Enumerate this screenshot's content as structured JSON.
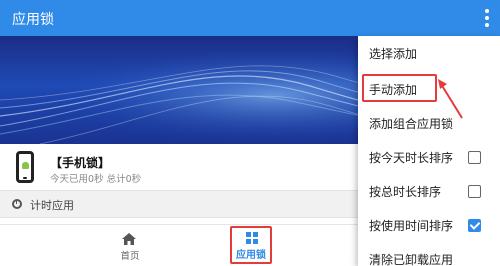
{
  "appbar": {
    "title": "应用锁",
    "more_icon": "more-vert-icon"
  },
  "info": {
    "title": "【手机锁】",
    "subtitle": "今天已用0秒 总计0秒",
    "icon": "phone-icon"
  },
  "section": {
    "label": "计时应用",
    "icon": "clock-icon"
  },
  "nav": {
    "home_label": "首页",
    "lock_label": "应用锁",
    "active_color": "#2f8ae8"
  },
  "menu": {
    "items": [
      {
        "label": "选择添加"
      },
      {
        "label": "手动添加"
      },
      {
        "label": "添加组合应用锁"
      },
      {
        "label": "按今天时长排序",
        "checked": false
      },
      {
        "label": "按总时长排序",
        "checked": false
      },
      {
        "label": "按使用时间排序",
        "checked": true
      },
      {
        "label": "清除已卸载应用"
      }
    ]
  },
  "colors": {
    "primary": "#2f8ae8",
    "annotation": "#e43c3c"
  }
}
